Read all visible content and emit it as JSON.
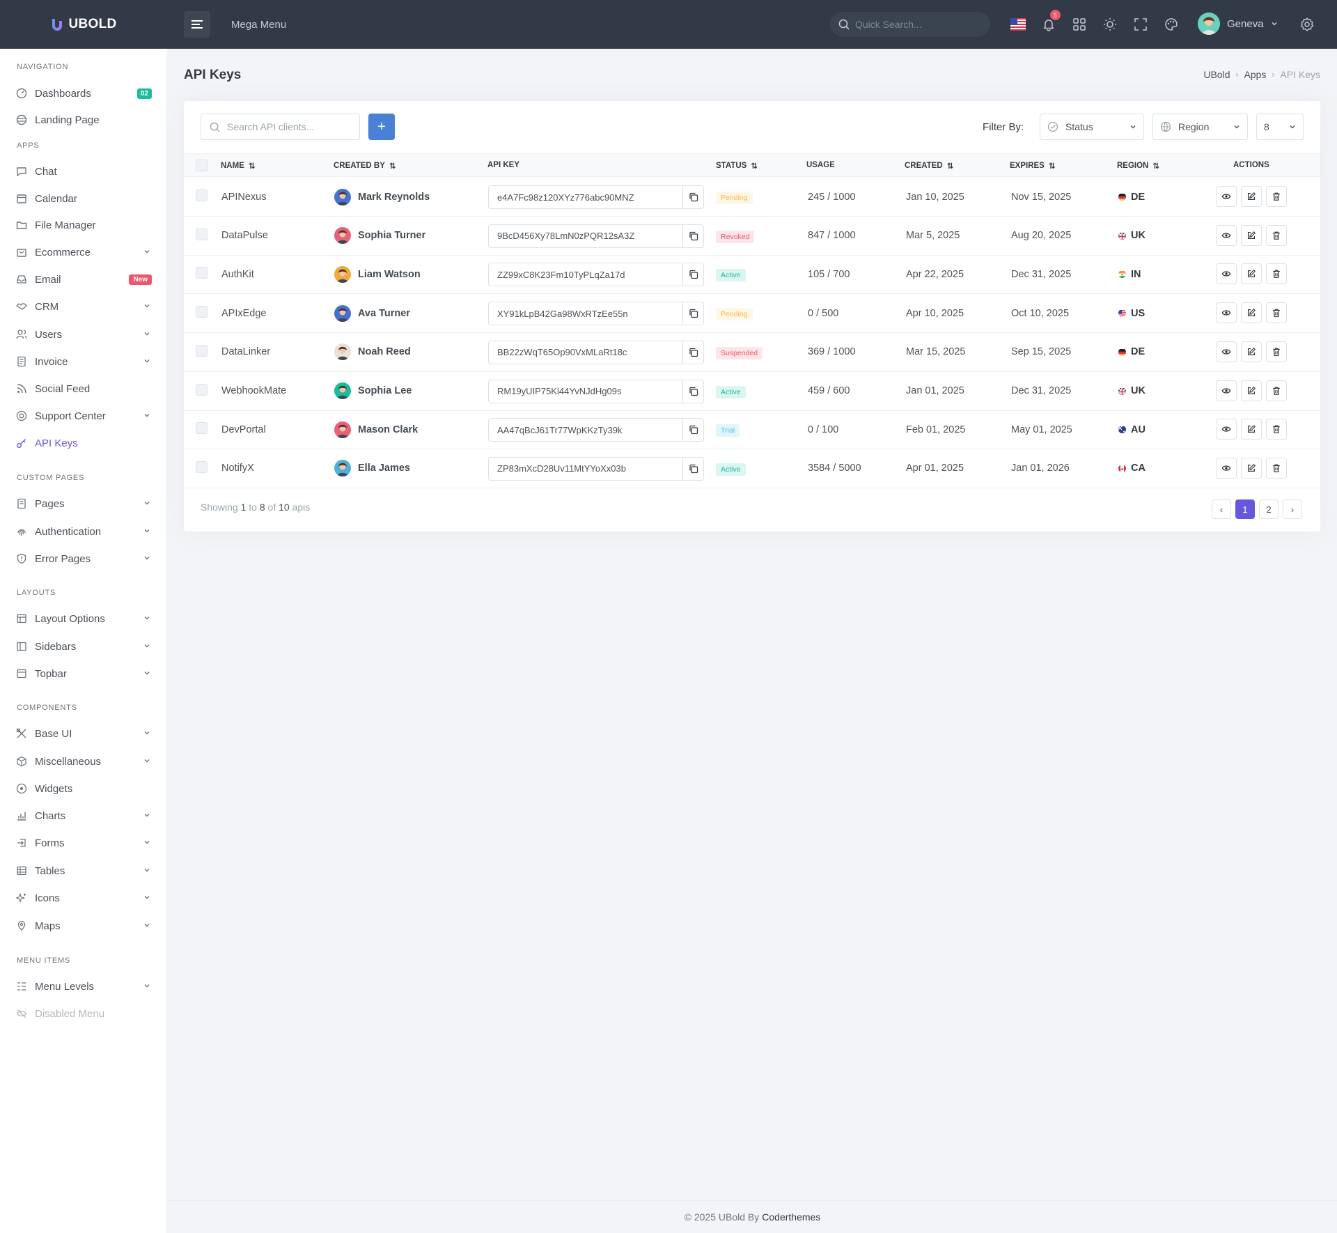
{
  "topbar": {
    "brand": "UBOLD",
    "mega_menu": "Mega Menu",
    "search_placeholder": "Quick Search...",
    "notification_count": "5",
    "user_name": "Geneva"
  },
  "sidebar": {
    "sections": {
      "navigation": "NAVIGATION",
      "apps": "APPS",
      "custom_pages": "CUSTOM PAGES",
      "layouts": "LAYOUTS",
      "components": "COMPONENTS",
      "menu_items": "MENU ITEMS"
    },
    "items": {
      "dashboards": "Dashboards",
      "dashboards_badge": "02",
      "landing": "Landing Page",
      "chat": "Chat",
      "calendar": "Calendar",
      "file_manager": "File Manager",
      "ecommerce": "Ecommerce",
      "email": "Email",
      "email_badge": "New",
      "crm": "CRM",
      "users": "Users",
      "invoice": "Invoice",
      "social_feed": "Social Feed",
      "support_center": "Support Center",
      "api_keys": "API Keys",
      "pages": "Pages",
      "authentication": "Authentication",
      "error_pages": "Error Pages",
      "layout_options": "Layout Options",
      "sidebars": "Sidebars",
      "topbar": "Topbar",
      "base_ui": "Base UI",
      "miscellaneous": "Miscellaneous",
      "widgets": "Widgets",
      "charts": "Charts",
      "forms": "Forms",
      "tables": "Tables",
      "icons": "Icons",
      "maps": "Maps",
      "menu_levels": "Menu Levels",
      "disabled_menu": "Disabled Menu"
    }
  },
  "page": {
    "title": "API Keys",
    "breadcrumb": [
      "UBold",
      "Apps",
      "API Keys"
    ]
  },
  "toolbar": {
    "search_placeholder": "Search API clients...",
    "add_label": "+",
    "filter_label": "Filter By:",
    "status_select": "Status",
    "region_select": "Region",
    "page_size": "8"
  },
  "table": {
    "headers": {
      "name": "NAME",
      "created_by": "CREATED BY",
      "api_key": "API KEY",
      "status": "STATUS",
      "usage": "USAGE",
      "created": "CREATED",
      "expires": "EXPIRES",
      "region": "REGION",
      "actions": "ACTIONS"
    },
    "rows": [
      {
        "name": "APINexus",
        "creator": "Mark Reynolds",
        "key": "e4A7Fc98z120XYz776abc90MNZ",
        "status": "Pending",
        "usage": "245 / 1000",
        "created": "Jan 10, 2025",
        "expires": "Nov 15, 2025",
        "region": "DE"
      },
      {
        "name": "DataPulse",
        "creator": "Sophia Turner",
        "key": "9BcD456Xy78LmN0zPQR12sA3Z",
        "status": "Revoked",
        "usage": "847 / 1000",
        "created": "Mar 5, 2025",
        "expires": "Aug 20, 2025",
        "region": "UK"
      },
      {
        "name": "AuthKit",
        "creator": "Liam Watson",
        "key": "ZZ99xC8K23Fm10TyPLqZa17d",
        "status": "Active",
        "usage": "105 / 700",
        "created": "Apr 22, 2025",
        "expires": "Dec 31, 2025",
        "region": "IN"
      },
      {
        "name": "APIxEdge",
        "creator": "Ava Turner",
        "key": "XY91kLpB42Ga98WxRTzEe55n",
        "status": "Pending",
        "usage": "0 / 500",
        "created": "Apr 10, 2025",
        "expires": "Oct 10, 2025",
        "region": "US"
      },
      {
        "name": "DataLinker",
        "creator": "Noah Reed",
        "key": "BB22zWqT65Op90VxMLaRt18c",
        "status": "Suspended",
        "usage": "369 / 1000",
        "created": "Mar 15, 2025",
        "expires": "Sep 15, 2025",
        "region": "DE"
      },
      {
        "name": "WebhookMate",
        "creator": "Sophia Lee",
        "key": "RM19yUIP75Kl44YvNJdHg09s",
        "status": "Active",
        "usage": "459 / 600",
        "created": "Jan 01, 2025",
        "expires": "Dec 31, 2025",
        "region": "UK"
      },
      {
        "name": "DevPortal",
        "creator": "Mason Clark",
        "key": "AA47qBcJ61Tr77WpKKzTy39k",
        "status": "Trial",
        "usage": "0 / 100",
        "created": "Feb 01, 2025",
        "expires": "May 01, 2025",
        "region": "AU"
      },
      {
        "name": "NotifyX",
        "creator": "Ella James",
        "key": "ZP83mXcD28Uv11MtYYoXx03b",
        "status": "Active",
        "usage": "3584 / 5000",
        "created": "Apr 01, 2025",
        "expires": "Jan 01, 2026",
        "region": "CA"
      }
    ]
  },
  "pagination": {
    "showing_prefix": "Showing",
    "from": "1",
    "to_word": "to",
    "to": "8",
    "of_word": "of",
    "total": "10",
    "suffix": "apis",
    "prev": "‹",
    "page1": "1",
    "page2": "2",
    "next": "›"
  },
  "footer": {
    "text": "© 2025 UBold By",
    "company": "Coderthemes"
  }
}
